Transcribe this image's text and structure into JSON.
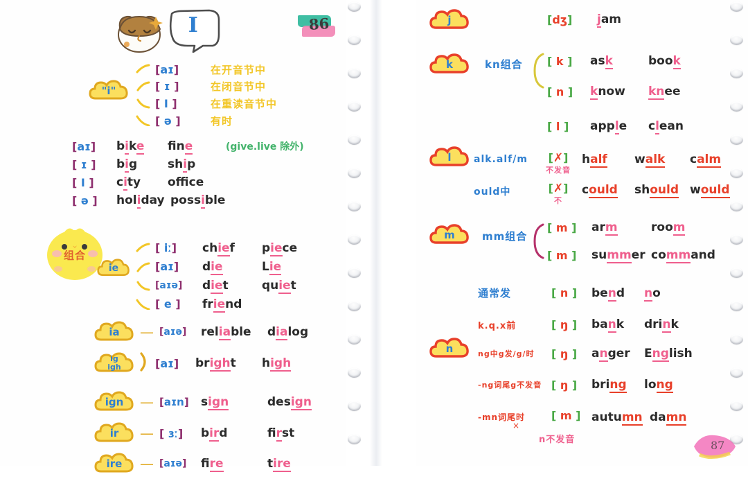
{
  "spread": {
    "page_number": "86",
    "left_page": {
      "stickers": {
        "hamster": "hamster-sticker",
        "bubble_letter": "I"
      },
      "topic_badge": {
        "label": "\"i\""
      },
      "topic_rules": [
        {
          "phonetic": "[aɪ]",
          "condition": "在开音节中"
        },
        {
          "phonetic": "[ɪ]",
          "condition": "在闭音节中"
        },
        {
          "phonetic": "[ɪ]",
          "condition": "在重读音节中"
        },
        {
          "phonetic": "[ə]",
          "condition": "有时"
        }
      ],
      "topic_examples": [
        {
          "phonetic": "[aɪ]",
          "words": [
            "bike",
            "fine"
          ],
          "note": "(give.live 除外)"
        },
        {
          "phonetic": "[ɪ]",
          "words": [
            "big",
            "ship"
          ],
          "note": ""
        },
        {
          "phonetic": "[I]",
          "words": [
            "city",
            "office"
          ],
          "note": ""
        },
        {
          "phonetic": "[ə]",
          "words": [
            "holiday",
            "possible"
          ],
          "note": ""
        }
      ],
      "combo_heading": "组合",
      "ie_badge": "ie",
      "ie_rules": [
        {
          "phonetic": "[iː]",
          "words": [
            "chief",
            "piece"
          ]
        },
        {
          "phonetic": "[aɪ]",
          "words": [
            "die",
            "Lie"
          ]
        },
        {
          "phonetic": "[aɪə]",
          "words": [
            "diet",
            "quiet"
          ]
        },
        {
          "phonetic": "[e]",
          "words": [
            "friend"
          ]
        }
      ],
      "combos": [
        {
          "badge": "ia",
          "phonetic": "[aɪə]",
          "words": [
            "reliable",
            "dialog"
          ]
        },
        {
          "badge": "ig\nigh",
          "phonetic": "[aɪ]",
          "words": [
            "bright",
            "high"
          ]
        },
        {
          "badge": "ign",
          "phonetic": "[aɪn]",
          "words": [
            "sign",
            "design"
          ]
        },
        {
          "badge": "ir",
          "phonetic": "[ɜː]",
          "words": [
            "bird",
            "first"
          ]
        },
        {
          "badge": "ire",
          "phonetic": "[aɪə]",
          "words": [
            "fire",
            "tire"
          ]
        }
      ]
    },
    "right_page": {
      "sections": [
        {
          "badge": "j",
          "rules": [
            {
              "condition": "",
              "phonetic": "[dʒ]",
              "words": [
                "jam"
              ]
            }
          ]
        },
        {
          "badge": "k",
          "group_label": "kn组合",
          "rules": [
            {
              "condition": "",
              "phonetic": "[k]",
              "words": [
                "ask",
                "book"
              ]
            },
            {
              "condition": "",
              "phonetic": "[n]",
              "words": [
                "know",
                "knee"
              ]
            }
          ]
        },
        {
          "badge": "l",
          "rules": [
            {
              "condition": "",
              "phonetic": "[l]",
              "words": [
                "apple",
                "clean"
              ]
            },
            {
              "condition": "alk.alf/m",
              "phonetic": "[✗]",
              "sub": "不发音",
              "words": [
                "half",
                "walk",
                "calm"
              ]
            },
            {
              "condition": "ould中",
              "phonetic": "[✗]",
              "sub": "不",
              "words": [
                "could",
                "should",
                "would"
              ]
            }
          ]
        },
        {
          "badge": "m",
          "group_label": "mm组合",
          "rules": [
            {
              "condition": "",
              "phonetic": "[m]",
              "words": [
                "arm",
                "room"
              ]
            },
            {
              "condition": "",
              "phonetic": "[m]",
              "words": [
                "summer",
                "command"
              ]
            }
          ]
        },
        {
          "badge": "n",
          "rules": [
            {
              "condition": "通常发",
              "phonetic": "[n]",
              "words": [
                "bend",
                "no"
              ]
            },
            {
              "condition": "k.q.x前",
              "phonetic": "[ŋ]",
              "words": [
                "bank",
                "drink"
              ]
            },
            {
              "condition": "ng中g发/g/时",
              "phonetic": "[ŋ]",
              "words": [
                "anger",
                "English"
              ]
            },
            {
              "condition": "-ng词尾g不发音",
              "phonetic": "[ŋ]",
              "words": [
                "bring",
                "long"
              ]
            },
            {
              "condition": "-mn词尾时",
              "phonetic": "[m]",
              "sub": "n不发音",
              "words": [
                "autumn",
                "damn"
              ]
            }
          ]
        }
      ]
    }
  },
  "colors": {
    "bracket_left": "#8e2f6e",
    "symbol_left": "#2f7fd0",
    "bracket_right": "#49a845",
    "symbol_right": "#e8402a",
    "underline_pink": "#ef5f8d",
    "underline_red": "#e8402a",
    "zh_yellow": "#f2c627",
    "zh_blue": "#2f7fd0",
    "cloud_left": "#f5c518",
    "cloud_right": "#e8402a"
  }
}
